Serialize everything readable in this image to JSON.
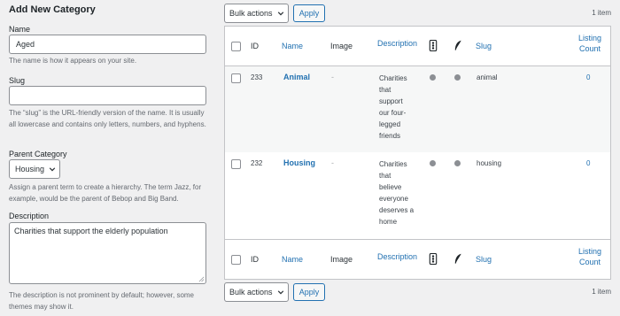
{
  "form": {
    "title": "Add New Category",
    "name_label": "Name",
    "name_value": "Aged",
    "name_help": "The name is how it appears on your site.",
    "slug_label": "Slug",
    "slug_value": "",
    "slug_help": "The “slug” is the URL-friendly version of the name. It is usually all lowercase and contains only letters, numbers, and hyphens.",
    "parent_label": "Parent Category",
    "parent_value": "Housing",
    "parent_help": "Assign a parent term to create a hierarchy. The term Jazz, for example, would be the parent of Bebop and Big Band.",
    "description_label": "Description",
    "description_value": "Charities that support the elderly population",
    "description_help": "The description is not prominent by default; however, some themes may show it."
  },
  "toolbar": {
    "bulk_label": "Bulk actions",
    "apply_label": "Apply",
    "item_count": "1 item"
  },
  "table": {
    "columns": {
      "id": "ID",
      "name": "Name",
      "image": "Image",
      "description": "Description",
      "slug": "Slug",
      "listing_count": [
        "Listing",
        "Count"
      ]
    },
    "rows": [
      {
        "id": "233",
        "name": "Animal",
        "image": "-",
        "description": [
          "Charities",
          "that",
          "support",
          "our four-",
          "legged",
          "friends"
        ],
        "slug": "animal",
        "count": "0"
      },
      {
        "id": "232",
        "name": "Housing",
        "image": "-",
        "description": [
          "Charities",
          "that",
          "believe",
          "everyone",
          "deserves a",
          "home"
        ],
        "slug": "housing",
        "count": "0"
      }
    ]
  },
  "icons": {
    "status_column": "traffic-light-icon",
    "feather_column": "feather-icon",
    "row_status": "gray-dot",
    "dot_color": "#8c8f94"
  },
  "colors": {
    "link": "#2271b1",
    "background": "#f0f0f1"
  }
}
